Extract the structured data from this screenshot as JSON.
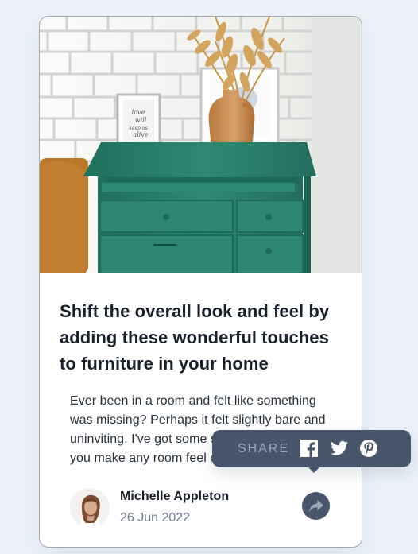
{
  "article": {
    "title": "Shift the overall look and feel by adding these wonderful touches to furniture in your home",
    "excerpt": "Ever been in a room and felt like something was missing? Perhaps it felt slightly bare and uninviting. I've got some simple tips to help you make any room feel complete.",
    "author": {
      "name": "Michelle Appleton",
      "date": "26 Jun 2022"
    }
  },
  "share": {
    "label": "SHARE",
    "icons": [
      "facebook-icon",
      "twitter-icon",
      "pinterest-icon"
    ],
    "button_icon": "share-icon"
  },
  "colors": {
    "page_background": "#ecf2f8",
    "card_background": "#ffffff",
    "heading": "#18212b",
    "body_text": "#25323d",
    "muted_text": "#6f7c8d",
    "share_panel": "#48556a",
    "share_label": "#9ea7b8",
    "dresser_green": "#2f8a73"
  }
}
